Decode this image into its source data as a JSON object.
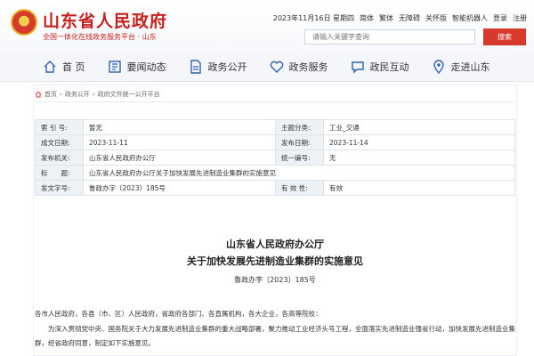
{
  "header": {
    "site_title": "山东省人民政府",
    "site_subtitle": "全国一体化在线政务服务平台 · 山东",
    "top_links": [
      "2023年11月16日 星期四",
      "简体",
      "繁体",
      "无障碍",
      "关怀版",
      "智能机器人",
      "登录",
      "注册"
    ],
    "search_placeholder": "请输入关键字查询",
    "search_button": "搜索"
  },
  "nav": {
    "items": [
      {
        "label": "首 页",
        "icon": "home-icon"
      },
      {
        "label": "要闻动态",
        "icon": "news-icon"
      },
      {
        "label": "政务公开",
        "icon": "document-icon"
      },
      {
        "label": "政务服务",
        "icon": "heart-service-icon"
      },
      {
        "label": "政民互动",
        "icon": "interaction-icon"
      },
      {
        "label": "走进山东",
        "icon": "location-icon"
      }
    ]
  },
  "breadcrumb": [
    "首页",
    "政务公开",
    "政府文件统一公开平台"
  ],
  "meta": {
    "index_label": "索 引 号:",
    "index_value": "暂无",
    "subject_label": "主题分类:",
    "subject_value": "工业_交通",
    "created_label": "成文日期:",
    "created_value": "2023-11-11",
    "published_label": "发布日期:",
    "published_value": "2023-11-14",
    "issuer_label": "发布机关:",
    "issuer_value": "山东省人民政府办公厅",
    "unified_label": "统一编号:",
    "unified_value": "无",
    "title_label": "标　　题:",
    "title_value": "山东省人民政府办公厅关于加快发展先进制造业集群的实施意见",
    "docno_label": "发文字号:",
    "docno_value": "鲁政办字〔2023〕185号",
    "validity_label": "有 效 性:",
    "validity_value": "有效"
  },
  "document": {
    "title_line1": "山东省人民政府办公厅",
    "title_line2": "关于加快发展先进制造业集群的实施意见",
    "doc_number": "鲁政办字〔2023〕185号",
    "salutation": "各市人民政府，各县（市、区）人民政府，省政府各部门、各直属机构，各大企业，各高等院校：",
    "para1": "为深入贯彻党中央、国务院关于大力发展先进制造业集群的重大战略部署，聚力推动工业经济头号工程，全面落实先进制造业强省行动，加快发展先进制造业集群，经省政府同意，制定如下实施意见。"
  },
  "colors": {
    "brand_red": "#c5221f",
    "search_red": "#d7392d",
    "label_bg": "#eef2f7",
    "nav_icon": "#2f62b3"
  }
}
